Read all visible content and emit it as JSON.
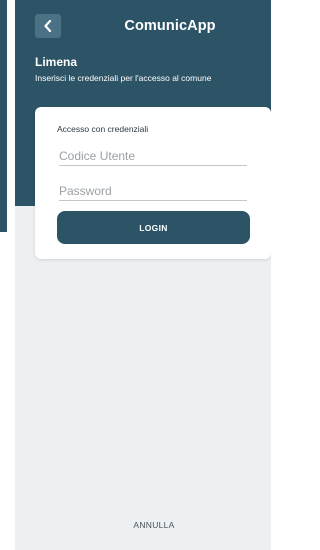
{
  "colors": {
    "primary": "#2d5366",
    "back_button": "#4b7184",
    "background": "#edf0f2",
    "card": "#ffffff"
  },
  "header": {
    "back_icon": "chevron-left-icon",
    "app_title": "ComunicApp",
    "comune_name": "Limena",
    "subtitle": "Inserisci le credenziali per l'accesso al comune"
  },
  "login_card": {
    "label": "Accesso con credenziali",
    "username_placeholder": "Codice Utente",
    "username_value": "",
    "password_placeholder": "Password",
    "password_value": "",
    "login_label": "LOGIN"
  },
  "footer": {
    "cancel_label": "ANNULLA"
  }
}
